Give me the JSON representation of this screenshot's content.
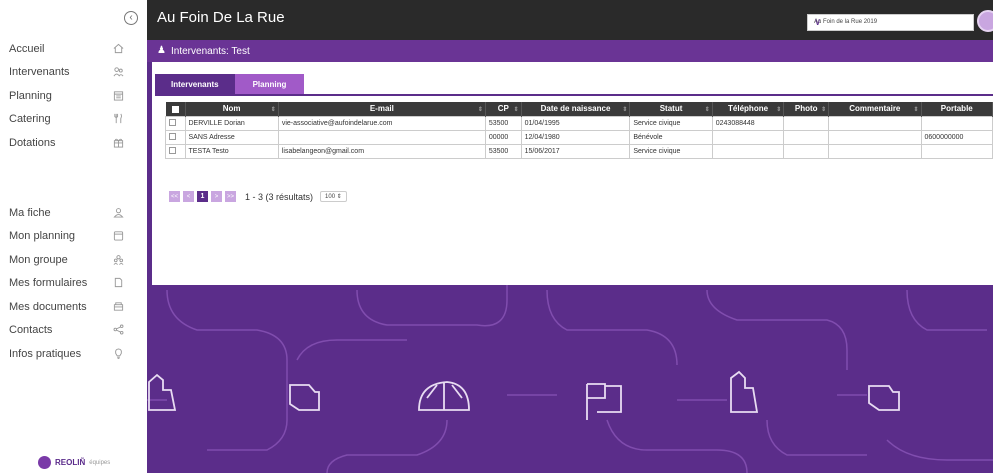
{
  "sidebar": {
    "collapse_icon": "chevron-left-circle-icon",
    "nav_top": [
      {
        "label": "Accueil",
        "icon": "home-icon"
      },
      {
        "label": "Intervenants",
        "icon": "people-icon"
      },
      {
        "label": "Planning",
        "icon": "calendar-icon"
      },
      {
        "label": "Catering",
        "icon": "cutlery-icon"
      },
      {
        "label": "Dotations",
        "icon": "gift-icon"
      }
    ],
    "nav_bottom": [
      {
        "label": "Ma fiche",
        "icon": "user-icon"
      },
      {
        "label": "Mon planning",
        "icon": "calendar-icon"
      },
      {
        "label": "Mon groupe",
        "icon": "group-icon"
      },
      {
        "label": "Mes formulaires",
        "icon": "form-icon"
      },
      {
        "label": "Mes documents",
        "icon": "folder-icon"
      },
      {
        "label": "Contacts",
        "icon": "share-icon"
      },
      {
        "label": "Infos pratiques",
        "icon": "lightbulb-icon"
      }
    ],
    "brand": "REOLIÑ",
    "brand_sub": "équipes"
  },
  "header": {
    "title": "Au Foin De La Rue",
    "event_selected": "Au Foin de la Rue 2019"
  },
  "section": {
    "title": "Intervenants: Test"
  },
  "tabs": [
    {
      "label": "Intervenants",
      "active": true
    },
    {
      "label": "Planning",
      "active": false
    }
  ],
  "table": {
    "columns": [
      "Nom",
      "E-mail",
      "CP",
      "Date de naissance",
      "Statut",
      "Téléphone",
      "Photo",
      "Commentaire",
      "Portable"
    ],
    "rows": [
      [
        "DERVILLE Dorian",
        "vie-associative@aufoindelarue.com",
        "53500",
        "01/04/1995",
        "Service civique",
        "0243088448",
        "",
        "",
        ""
      ],
      [
        "SANS Adresse",
        "",
        "00000",
        "12/04/1980",
        "Bénévole",
        "",
        "",
        "",
        "0600000000"
      ],
      [
        "TESTA Testo",
        "lisabelangeon@gmail.com",
        "53500",
        "15/06/2017",
        "Service civique",
        "",
        "",
        "",
        ""
      ]
    ]
  },
  "pager": {
    "first": "<<",
    "prev": "<",
    "current": "1",
    "next": ">",
    "last": ">>",
    "results": "1 - 3 (3 résultats)",
    "per_page": "100 ⇕"
  },
  "colors": {
    "accent": "#5b2d8a",
    "tab_inactive": "#a15ac8",
    "topbar": "#2a2a2a"
  }
}
